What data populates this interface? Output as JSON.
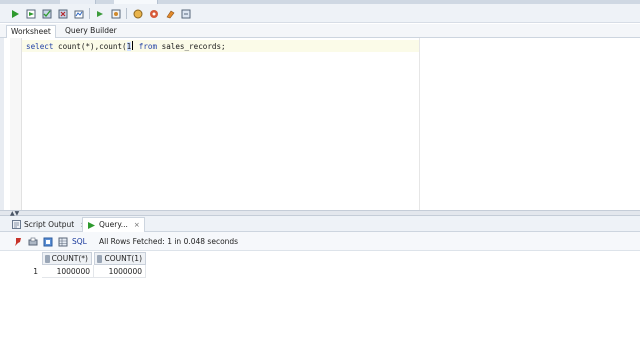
{
  "toolbar": {
    "buttons": [
      "run-statement",
      "run-script",
      "commit",
      "rollback",
      "autotrace",
      "explain-plan",
      "sql-tuning",
      "clear",
      "history",
      "sql-formatter",
      "unshared-sql"
    ]
  },
  "subtabs": {
    "worksheet": "Worksheet",
    "query_builder": "Query Builder"
  },
  "editor": {
    "kw_select": "select",
    "part1": " count(*),count(",
    "hl": "1",
    "kw_from": "from",
    "part2": " sales_records;"
  },
  "output": {
    "script_output_tab": "Script Output",
    "query_result_tab": "Query...",
    "close": "×"
  },
  "results": {
    "sql_label": "SQL",
    "status": "All Rows Fetched: 1 in 0.048 seconds",
    "columns": [
      "COUNT(*)",
      "COUNT(1)"
    ],
    "rows": [
      {
        "num": "1",
        "cells": [
          "1000000",
          "1000000"
        ]
      }
    ]
  },
  "colors": {
    "run_green": "#2e9a2e",
    "keyword_blue": "#1f3fa6"
  }
}
